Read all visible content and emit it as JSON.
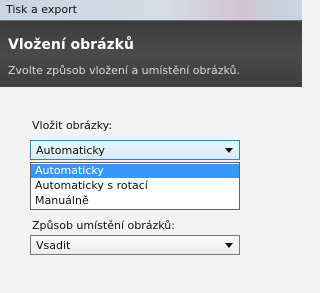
{
  "window": {
    "title": "Tisk a export"
  },
  "header": {
    "title": "Vložení obrázků",
    "subtitle": "Zvolte způsob vložení a umístění obrázků."
  },
  "insert_images": {
    "label": "Vložit obrázky:",
    "value": "Automaticky",
    "options": [
      "Automaticky",
      "Automaticky s rotací",
      "Manuálně"
    ],
    "selected_index": 0
  },
  "placement": {
    "label": "Způsob umístění obrázků:",
    "value": "Vsadit"
  },
  "colors": {
    "header_bg": "#444444",
    "selection": "#3399ff"
  }
}
